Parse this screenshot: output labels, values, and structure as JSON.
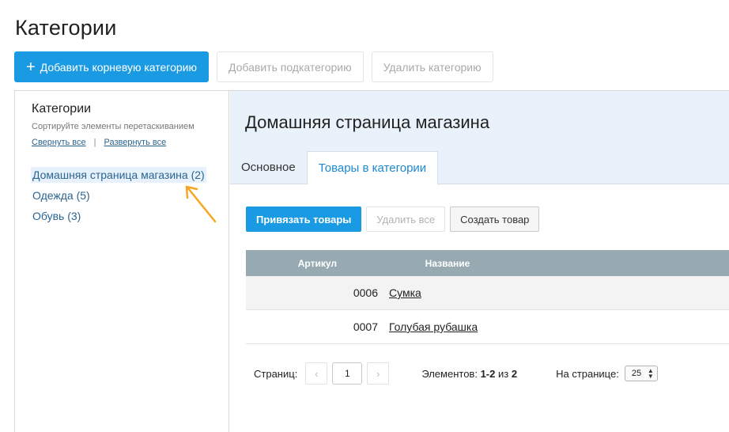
{
  "page": {
    "title": "Категории"
  },
  "toolbar": {
    "add_root": "Добавить корневую категорию",
    "add_sub": "Добавить подкатегорию",
    "delete": "Удалить категорию"
  },
  "sidebar": {
    "title": "Категории",
    "hint": "Сортируйте элементы перетаскиванием",
    "collapse": "Свернуть все",
    "separator": "|",
    "expand": "Развернуть все",
    "items": [
      {
        "label": "Домашняя страница магазина (2)",
        "selected": true
      },
      {
        "label": "Одежда (5)"
      },
      {
        "label": "Обувь (3)"
      }
    ]
  },
  "main": {
    "title": "Домашняя страница магазина",
    "tabs": [
      {
        "label": "Основное"
      },
      {
        "label": "Товары в категории",
        "active": true
      }
    ],
    "actions": {
      "attach": "Привязать товары",
      "delete_all": "Удалить все",
      "create": "Создать товар"
    },
    "table": {
      "headers": {
        "sku": "Артикул",
        "name": "Название"
      },
      "rows": [
        {
          "sku": "0006",
          "name": "Сумка"
        },
        {
          "sku": "0007",
          "name": "Голубая рубашка"
        }
      ]
    },
    "pager": {
      "pages_label": "Страниц:",
      "prev": "‹",
      "current": "1",
      "next": "›",
      "items_label": "Элементов:",
      "items_range": "1-2",
      "items_of": "из",
      "items_total": "2",
      "per_page_label": "На странице:",
      "per_page": "25"
    }
  },
  "colors": {
    "accent": "#1b9ae4",
    "arrow": "#f5a623",
    "header_bg": "#e9f2fa",
    "table_head": "#97aab2"
  }
}
